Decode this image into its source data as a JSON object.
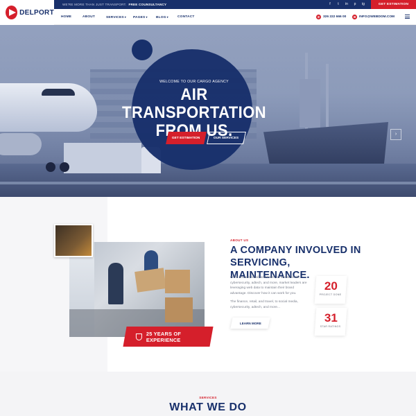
{
  "brand": {
    "name": "DELPORT"
  },
  "topbar": {
    "announcement": "WE'RE MORE THAN JUST TRANSPORT.",
    "announcement_strong": "FREE COUNSULTANCY",
    "social": [
      "f",
      "t",
      "in",
      "p",
      "ig"
    ],
    "cta": "GET ESTIMATION"
  },
  "nav": {
    "items": [
      {
        "label": "HOME"
      },
      {
        "label": "ABOUT"
      },
      {
        "label": "SERVICES"
      },
      {
        "label": "PAGES"
      },
      {
        "label": "BLOG"
      },
      {
        "label": "CONTACT"
      }
    ],
    "phone": "326 222 666 00",
    "email": "INFO@WEBDOM.COM"
  },
  "hero": {
    "welcome": "WELCOME TO OUR CARGO AGENCY",
    "title_line1": "AIR TRANSPORTATION",
    "title_line2": "FROM US.",
    "primary_button": "GET ESTIMATION",
    "secondary_button": "OUR SERVICES"
  },
  "about": {
    "tag": "ABOUT US",
    "title_line1": "A COMPANY INVOLVED IN",
    "title_line2": "SERVICING, MAINTENANCE.",
    "paragraph1": "From finance, retail, and travel, to social media, cybersecurity, adtech, and more, market leaders are leveraging web data to maintain their brand advantage. Discover how it can work for you.",
    "paragraph2": "The finance, retail, and travel, to social media, cybersecurity, adtech, and more...",
    "button": "LEARN MORE",
    "experience": "25 YEARS OF EXPERIENCE",
    "stats": [
      {
        "value": "20",
        "label": "PROJECT DONE"
      },
      {
        "value": "31",
        "label": "STAR RATINGS"
      }
    ]
  },
  "services": {
    "tag": "SERVICES",
    "title": "WHAT WE DO"
  },
  "colors": {
    "primary": "#18306b",
    "accent": "#d51f2b"
  }
}
